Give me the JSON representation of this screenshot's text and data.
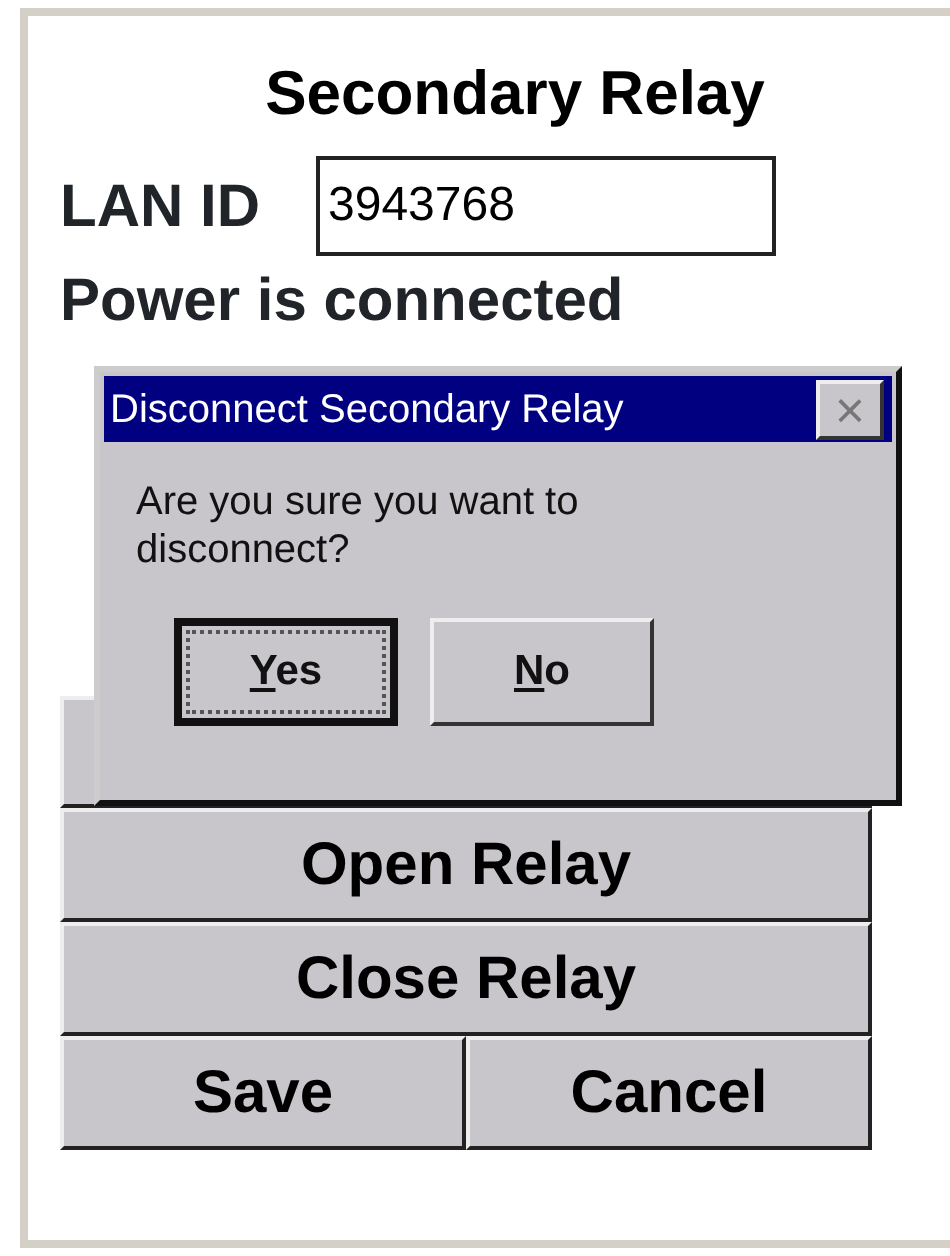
{
  "title": "Secondary Relay",
  "lan_id": {
    "label": "LAN ID",
    "value": "3943768"
  },
  "status": "Power is connected",
  "buttons": [
    {
      "label": "Open Relay"
    },
    {
      "label": "Close Relay"
    }
  ],
  "footer_buttons": [
    {
      "label": "Save"
    },
    {
      "label": "Cancel"
    }
  ],
  "dialog": {
    "title": "Disconnect Secondary Relay",
    "close": "×",
    "message": "Are you sure you want to disconnect?",
    "buttons": [
      {
        "mnemonic": "Y",
        "rest": "es",
        "focused": true
      },
      {
        "mnemonic": "N",
        "rest": "o",
        "focused": false
      }
    ]
  }
}
